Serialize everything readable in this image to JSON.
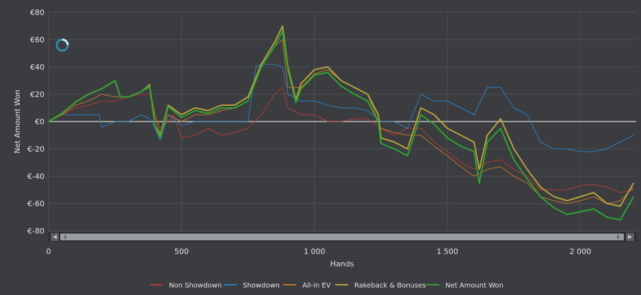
{
  "chart_data": {
    "type": "line",
    "xlabel": "Hands",
    "ylabel": "Net Amount Won",
    "xlim": [
      0,
      2210
    ],
    "ylim": [
      -80,
      80
    ],
    "x_ticks": [
      0,
      500,
      1000,
      1500,
      2000
    ],
    "x_tick_labels": [
      "0",
      "500",
      "1 000",
      "1 500",
      "2 000"
    ],
    "y_ticks": [
      -80,
      -60,
      -40,
      -20,
      0,
      20,
      40,
      60,
      80
    ],
    "y_tick_labels": [
      "€-80",
      "€-60",
      "€-40",
      "€-20",
      "€0",
      "€20",
      "€40",
      "€60",
      "€80"
    ],
    "grid": true,
    "legend_position": "bottom",
    "series": [
      {
        "name": "Non Showdown",
        "color": "#b73a3a",
        "points": [
          [
            0,
            0
          ],
          [
            50,
            5
          ],
          [
            100,
            10
          ],
          [
            150,
            12
          ],
          [
            200,
            15
          ],
          [
            250,
            15
          ],
          [
            300,
            18
          ],
          [
            350,
            20
          ],
          [
            380,
            20
          ],
          [
            400,
            5
          ],
          [
            420,
            -5
          ],
          [
            450,
            0
          ],
          [
            470,
            5
          ],
          [
            500,
            -12
          ],
          [
            550,
            -10
          ],
          [
            600,
            -5
          ],
          [
            650,
            -10
          ],
          [
            700,
            -8
          ],
          [
            750,
            -5
          ],
          [
            800,
            5
          ],
          [
            850,
            20
          ],
          [
            880,
            25
          ],
          [
            900,
            10
          ],
          [
            950,
            5
          ],
          [
            1000,
            5
          ],
          [
            1050,
            0
          ],
          [
            1100,
            0
          ],
          [
            1150,
            2
          ],
          [
            1200,
            2
          ],
          [
            1250,
            -5
          ],
          [
            1300,
            -10
          ],
          [
            1350,
            -5
          ],
          [
            1400,
            -5
          ],
          [
            1450,
            -15
          ],
          [
            1500,
            -22
          ],
          [
            1550,
            -30
          ],
          [
            1600,
            -35
          ],
          [
            1650,
            -30
          ],
          [
            1700,
            -28
          ],
          [
            1750,
            -35
          ],
          [
            1800,
            -40
          ],
          [
            1850,
            -50
          ],
          [
            1900,
            -50
          ],
          [
            1950,
            -50
          ],
          [
            2000,
            -47
          ],
          [
            2050,
            -46
          ],
          [
            2100,
            -48
          ],
          [
            2150,
            -52
          ],
          [
            2200,
            -50
          ]
        ]
      },
      {
        "name": "Showdown",
        "color": "#2f7fc2",
        "points": [
          [
            0,
            0
          ],
          [
            50,
            5
          ],
          [
            100,
            5
          ],
          [
            150,
            5
          ],
          [
            190,
            5
          ],
          [
            200,
            -4
          ],
          [
            250,
            0
          ],
          [
            300,
            0
          ],
          [
            350,
            5
          ],
          [
            380,
            2
          ],
          [
            400,
            -5
          ],
          [
            420,
            -14
          ],
          [
            450,
            5
          ],
          [
            500,
            -3
          ],
          [
            550,
            0
          ],
          [
            600,
            0
          ],
          [
            650,
            0
          ],
          [
            700,
            0
          ],
          [
            750,
            0
          ],
          [
            780,
            40
          ],
          [
            800,
            42
          ],
          [
            850,
            42
          ],
          [
            880,
            40
          ],
          [
            900,
            20
          ],
          [
            950,
            15
          ],
          [
            1000,
            15
          ],
          [
            1050,
            12
          ],
          [
            1100,
            10
          ],
          [
            1150,
            10
          ],
          [
            1200,
            8
          ],
          [
            1250,
            0
          ],
          [
            1300,
            0
          ],
          [
            1350,
            -5
          ],
          [
            1400,
            20
          ],
          [
            1450,
            15
          ],
          [
            1500,
            15
          ],
          [
            1550,
            10
          ],
          [
            1600,
            5
          ],
          [
            1650,
            25
          ],
          [
            1700,
            25
          ],
          [
            1750,
            10
          ],
          [
            1800,
            5
          ],
          [
            1850,
            -15
          ],
          [
            1900,
            -20
          ],
          [
            1950,
            -20
          ],
          [
            2000,
            -22
          ],
          [
            2050,
            -22
          ],
          [
            2100,
            -20
          ],
          [
            2150,
            -15
          ],
          [
            2200,
            -10
          ]
        ]
      },
      {
        "name": "All-in EV",
        "color": "#c0762a",
        "points": [
          [
            0,
            0
          ],
          [
            50,
            5
          ],
          [
            100,
            12
          ],
          [
            150,
            15
          ],
          [
            200,
            20
          ],
          [
            250,
            18
          ],
          [
            300,
            18
          ],
          [
            350,
            22
          ],
          [
            380,
            25
          ],
          [
            400,
            5
          ],
          [
            420,
            -10
          ],
          [
            450,
            5
          ],
          [
            500,
            0
          ],
          [
            550,
            5
          ],
          [
            600,
            5
          ],
          [
            650,
            8
          ],
          [
            700,
            10
          ],
          [
            750,
            15
          ],
          [
            800,
            40
          ],
          [
            850,
            55
          ],
          [
            880,
            60
          ],
          [
            900,
            25
          ],
          [
            950,
            25
          ],
          [
            1000,
            35
          ],
          [
            1050,
            38
          ],
          [
            1100,
            30
          ],
          [
            1150,
            25
          ],
          [
            1200,
            20
          ],
          [
            1250,
            -5
          ],
          [
            1300,
            -8
          ],
          [
            1350,
            -10
          ],
          [
            1400,
            -10
          ],
          [
            1450,
            -18
          ],
          [
            1500,
            -25
          ],
          [
            1550,
            -33
          ],
          [
            1600,
            -40
          ],
          [
            1650,
            -35
          ],
          [
            1700,
            -33
          ],
          [
            1750,
            -40
          ],
          [
            1800,
            -45
          ],
          [
            1850,
            -55
          ],
          [
            1900,
            -58
          ],
          [
            1950,
            -60
          ],
          [
            2000,
            -58
          ],
          [
            2050,
            -55
          ],
          [
            2100,
            -60
          ],
          [
            2150,
            -58
          ],
          [
            2200,
            -48
          ]
        ]
      },
      {
        "name": "Rakeback & Bonuses",
        "color": "#b7a33a",
        "points": [
          [
            0,
            0
          ],
          [
            50,
            6
          ],
          [
            100,
            14
          ],
          [
            150,
            20
          ],
          [
            200,
            24
          ],
          [
            250,
            30
          ],
          [
            270,
            18
          ],
          [
            300,
            18
          ],
          [
            350,
            22
          ],
          [
            380,
            27
          ],
          [
            400,
            -3
          ],
          [
            420,
            -10
          ],
          [
            450,
            12
          ],
          [
            500,
            5
          ],
          [
            550,
            10
          ],
          [
            600,
            8
          ],
          [
            650,
            12
          ],
          [
            700,
            12
          ],
          [
            750,
            18
          ],
          [
            800,
            42
          ],
          [
            850,
            58
          ],
          [
            880,
            70
          ],
          [
            900,
            40
          ],
          [
            930,
            16
          ],
          [
            950,
            28
          ],
          [
            1000,
            38
          ],
          [
            1050,
            40
          ],
          [
            1100,
            30
          ],
          [
            1150,
            25
          ],
          [
            1200,
            20
          ],
          [
            1240,
            5
          ],
          [
            1250,
            -12
          ],
          [
            1300,
            -15
          ],
          [
            1350,
            -20
          ],
          [
            1400,
            10
          ],
          [
            1450,
            5
          ],
          [
            1500,
            -5
          ],
          [
            1550,
            -10
          ],
          [
            1600,
            -15
          ],
          [
            1620,
            -35
          ],
          [
            1650,
            -10
          ],
          [
            1700,
            2
          ],
          [
            1750,
            -20
          ],
          [
            1800,
            -35
          ],
          [
            1850,
            -48
          ],
          [
            1900,
            -55
          ],
          [
            1950,
            -58
          ],
          [
            2000,
            -55
          ],
          [
            2050,
            -52
          ],
          [
            2100,
            -60
          ],
          [
            2150,
            -62
          ],
          [
            2200,
            -45
          ]
        ]
      },
      {
        "name": "Net Amount Won",
        "color": "#2fa52f",
        "points": [
          [
            0,
            0
          ],
          [
            50,
            6
          ],
          [
            100,
            14
          ],
          [
            150,
            20
          ],
          [
            200,
            24
          ],
          [
            250,
            30
          ],
          [
            270,
            18
          ],
          [
            300,
            18
          ],
          [
            350,
            22
          ],
          [
            380,
            26
          ],
          [
            400,
            -3
          ],
          [
            420,
            -12
          ],
          [
            450,
            11
          ],
          [
            500,
            3
          ],
          [
            550,
            8
          ],
          [
            600,
            6
          ],
          [
            650,
            10
          ],
          [
            700,
            10
          ],
          [
            750,
            15
          ],
          [
            800,
            40
          ],
          [
            850,
            55
          ],
          [
            880,
            66
          ],
          [
            900,
            38
          ],
          [
            930,
            14
          ],
          [
            950,
            24
          ],
          [
            1000,
            34
          ],
          [
            1050,
            36
          ],
          [
            1100,
            26
          ],
          [
            1150,
            20
          ],
          [
            1200,
            15
          ],
          [
            1240,
            0
          ],
          [
            1250,
            -16
          ],
          [
            1300,
            -20
          ],
          [
            1350,
            -25
          ],
          [
            1400,
            5
          ],
          [
            1450,
            -2
          ],
          [
            1500,
            -12
          ],
          [
            1550,
            -18
          ],
          [
            1600,
            -22
          ],
          [
            1620,
            -45
          ],
          [
            1650,
            -15
          ],
          [
            1700,
            -5
          ],
          [
            1750,
            -28
          ],
          [
            1800,
            -42
          ],
          [
            1850,
            -55
          ],
          [
            1900,
            -63
          ],
          [
            1950,
            -68
          ],
          [
            2000,
            -66
          ],
          [
            2050,
            -64
          ],
          [
            2100,
            -70
          ],
          [
            2150,
            -72
          ],
          [
            2200,
            -55
          ]
        ]
      }
    ]
  }
}
